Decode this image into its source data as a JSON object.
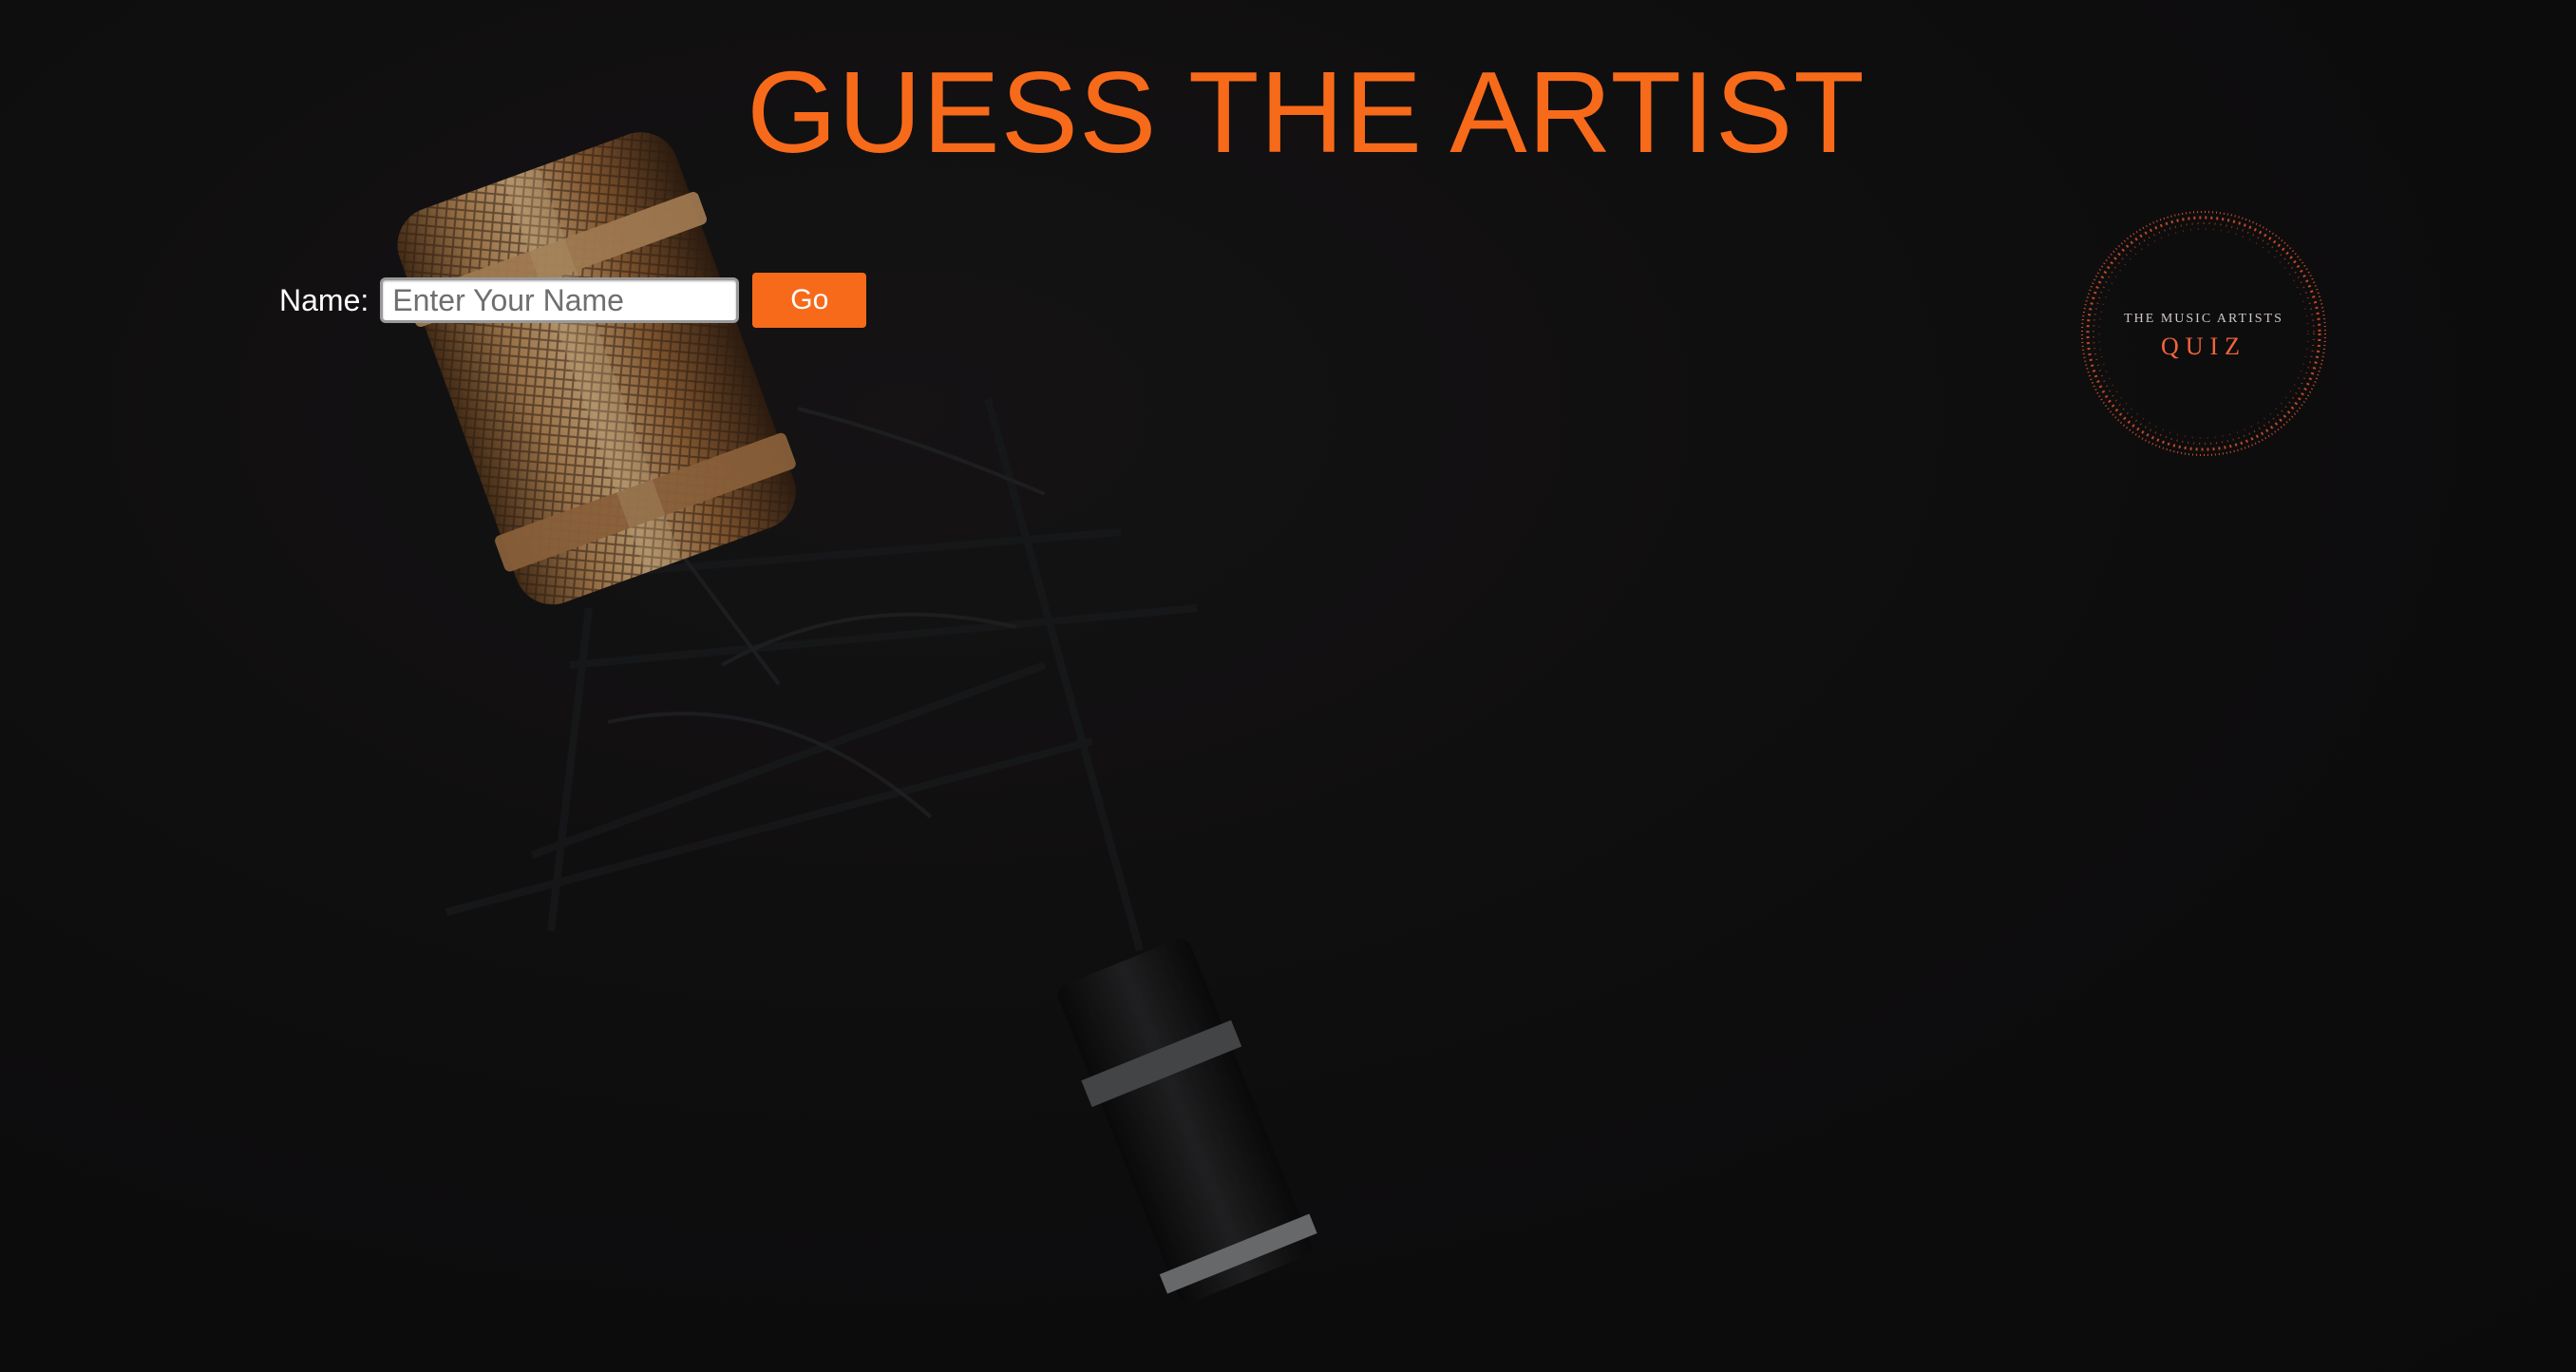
{
  "header": {
    "title": "GUESS THE ARTIST"
  },
  "form": {
    "name_label": "Name:",
    "name_placeholder": "Enter Your Name",
    "name_value": "",
    "go_label": "Go"
  },
  "logo": {
    "line1": "THE MUSIC ARTISTS",
    "line2": "QUIZ"
  },
  "colors": {
    "accent": "#f76a1a",
    "background": "#141314",
    "logo_text": "#f2643a",
    "label": "#ffffff"
  },
  "icons": {
    "background": "microphone-photo",
    "logo": "quiz-logo-dotted-circle"
  }
}
